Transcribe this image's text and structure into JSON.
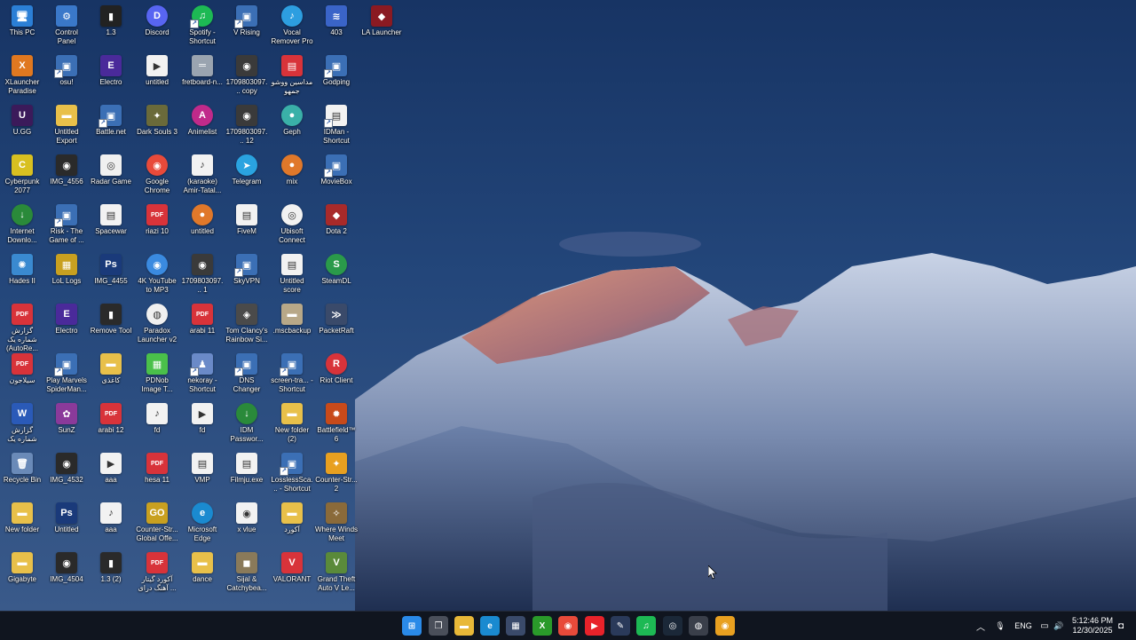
{
  "desktop_icons": [
    {
      "label": "This PC",
      "col": 0,
      "row": 0,
      "color": "#2b7fd6",
      "glyph": "🖥"
    },
    {
      "label": "Control Panel",
      "col": 1,
      "row": 0,
      "color": "#3a78c9",
      "glyph": "⚙"
    },
    {
      "label": "1.3",
      "col": 2,
      "row": 0,
      "color": "#222",
      "glyph": "▮"
    },
    {
      "label": "Discord",
      "col": 3,
      "row": 0,
      "color": "#5865f2",
      "glyph": "D",
      "round": true
    },
    {
      "label": "Spotify - Shortcut",
      "col": 4,
      "row": 0,
      "color": "#1db954",
      "glyph": "♫",
      "round": true,
      "shortcut": true
    },
    {
      "label": "V Rising",
      "col": 5,
      "row": 0,
      "color": "#3b6fb5",
      "glyph": "▣",
      "shortcut": true
    },
    {
      "label": "Vocal Remover Pro",
      "col": 6,
      "row": 0,
      "color": "#2d9ee0",
      "glyph": "♪",
      "round": true
    },
    {
      "label": "403",
      "col": 7,
      "row": 0,
      "color": "#3a64c8",
      "glyph": "≋"
    },
    {
      "label": "LA Launcher",
      "col": 8,
      "row": 0,
      "color": "#8a1a22",
      "glyph": "◆"
    },
    {
      "label": "XLauncher Paradise",
      "col": 0,
      "row": 1,
      "color": "#e07820",
      "glyph": "X"
    },
    {
      "label": "osu!",
      "col": 1,
      "row": 1,
      "color": "#3b6fb5",
      "glyph": "▣",
      "shortcut": true
    },
    {
      "label": "Electro",
      "col": 2,
      "row": 1,
      "color": "#4a2a9a",
      "glyph": "E"
    },
    {
      "label": "untitled",
      "col": 3,
      "row": 1,
      "color": "#f2f2f2",
      "glyph": "▶",
      "dark": true
    },
    {
      "label": "fretboard-n...",
      "col": 4,
      "row": 1,
      "color": "#9aa4b0",
      "glyph": "═"
    },
    {
      "label": "1709803097... copy",
      "col": 5,
      "row": 1,
      "color": "#3a3a3a",
      "glyph": "◉"
    },
    {
      "label": "مداسین ووشو جمهو",
      "col": 6,
      "row": 1,
      "color": "#d8333a",
      "glyph": "▤"
    },
    {
      "label": "Godping",
      "col": 7,
      "row": 1,
      "color": "#3b6fb5",
      "glyph": "▣",
      "shortcut": true
    },
    {
      "label": "U.GG",
      "col": 0,
      "row": 2,
      "color": "#3b1a5a",
      "glyph": "U"
    },
    {
      "label": "Untitled Export",
      "col": 1,
      "row": 2,
      "color": "#e8c04a",
      "glyph": "▬"
    },
    {
      "label": "Battle.net",
      "col": 2,
      "row": 2,
      "color": "#3b6fb5",
      "glyph": "▣",
      "shortcut": true
    },
    {
      "label": "Dark Souls 3",
      "col": 3,
      "row": 2,
      "color": "#6a6a3a",
      "glyph": "✦"
    },
    {
      "label": "Animelist",
      "col": 4,
      "row": 2,
      "color": "#c02a8a",
      "glyph": "A",
      "round": true
    },
    {
      "label": "1709803097... 12",
      "col": 5,
      "row": 2,
      "color": "#3a3a3a",
      "glyph": "◉"
    },
    {
      "label": "Geph",
      "col": 6,
      "row": 2,
      "color": "#3ab0a8",
      "glyph": "●",
      "round": true
    },
    {
      "label": "IDMan - Shortcut",
      "col": 7,
      "row": 2,
      "color": "#f2f2f2",
      "glyph": "▤",
      "dark": true,
      "shortcut": true
    },
    {
      "label": "Cyberpunk 2077",
      "col": 0,
      "row": 3,
      "color": "#d8c020",
      "glyph": "C"
    },
    {
      "label": "IMG_4556",
      "col": 1,
      "row": 3,
      "color": "#2a2a2a",
      "glyph": "◉"
    },
    {
      "label": "Radar Game",
      "col": 2,
      "row": 3,
      "color": "#f0f0f0",
      "glyph": "◎",
      "dark": true
    },
    {
      "label": "Google Chrome",
      "col": 3,
      "row": 3,
      "color": "#e84a3a",
      "glyph": "◉",
      "round": true
    },
    {
      "label": "(karaoke) Amir-Tatal...",
      "col": 4,
      "row": 3,
      "color": "#f2f2f2",
      "glyph": "♪",
      "dark": true
    },
    {
      "label": "Telegram",
      "col": 5,
      "row": 3,
      "color": "#2aa3e0",
      "glyph": "➤",
      "round": true
    },
    {
      "label": "mix",
      "col": 6,
      "row": 3,
      "color": "#e0782a",
      "glyph": "●",
      "round": true
    },
    {
      "label": "MovieBox",
      "col": 7,
      "row": 3,
      "color": "#3b6fb5",
      "glyph": "▣",
      "shortcut": true
    },
    {
      "label": "Internet Downlo...",
      "col": 0,
      "row": 4,
      "color": "#2a8a3a",
      "glyph": "↓",
      "round": true
    },
    {
      "label": "Risk - The Game of ...",
      "col": 1,
      "row": 4,
      "color": "#3b6fb5",
      "glyph": "▣",
      "shortcut": true
    },
    {
      "label": "Spacewar",
      "col": 2,
      "row": 4,
      "color": "#f2f2f2",
      "glyph": "▤",
      "dark": true
    },
    {
      "label": "riazi 10",
      "col": 3,
      "row": 4,
      "color": "#d8333a",
      "glyph": "PDF"
    },
    {
      "label": "untitled",
      "col": 4,
      "row": 4,
      "color": "#e0782a",
      "glyph": "●",
      "round": true
    },
    {
      "label": "FiveM",
      "col": 5,
      "row": 4,
      "color": "#f2f2f2",
      "glyph": "▤",
      "dark": true
    },
    {
      "label": "Ubisoft Connect",
      "col": 6,
      "row": 4,
      "color": "#f2f2f2",
      "glyph": "◎",
      "dark": true,
      "round": true
    },
    {
      "label": "Dota 2",
      "col": 7,
      "row": 4,
      "color": "#a82a2a",
      "glyph": "◆"
    },
    {
      "label": "Hades II",
      "col": 0,
      "row": 5,
      "color": "#3a8ad0",
      "glyph": "✺"
    },
    {
      "label": "LoL Logs",
      "col": 1,
      "row": 5,
      "color": "#c8a020",
      "glyph": "▦"
    },
    {
      "label": "IMG_4455",
      "col": 2,
      "row": 5,
      "color": "#1a3a7a",
      "glyph": "Ps"
    },
    {
      "label": "4K YouTube to MP3",
      "col": 3,
      "row": 5,
      "color": "#3a8ae0",
      "glyph": "◉",
      "round": true
    },
    {
      "label": "1709803097... 1",
      "col": 4,
      "row": 5,
      "color": "#3a3a3a",
      "glyph": "◉"
    },
    {
      "label": "SkyVPN",
      "col": 5,
      "row": 5,
      "color": "#3b6fb5",
      "glyph": "▣",
      "shortcut": true
    },
    {
      "label": "Untitled score",
      "col": 6,
      "row": 5,
      "color": "#f2f2f2",
      "glyph": "▤",
      "dark": true
    },
    {
      "label": "SteamDL",
      "col": 7,
      "row": 5,
      "color": "#2a9a4a",
      "glyph": "S",
      "round": true
    },
    {
      "label": "گزارش شماره یک (AutoRe...",
      "col": 0,
      "row": 6,
      "color": "#d8333a",
      "glyph": "PDF"
    },
    {
      "label": "Electro",
      "col": 1,
      "row": 6,
      "color": "#4a2a9a",
      "glyph": "E"
    },
    {
      "label": "Remove Tool",
      "col": 2,
      "row": 6,
      "color": "#2a2a2a",
      "glyph": "▮"
    },
    {
      "label": "Paradox Launcher v2",
      "col": 3,
      "row": 6,
      "color": "#f0f0f0",
      "glyph": "◍",
      "dark": true,
      "round": true
    },
    {
      "label": "arabi 11",
      "col": 4,
      "row": 6,
      "color": "#d8333a",
      "glyph": "PDF"
    },
    {
      "label": "Tom Clancy's Rainbow Si...",
      "col": 5,
      "row": 6,
      "color": "#4a4a4a",
      "glyph": "◈"
    },
    {
      "label": ".mscbackup",
      "col": 6,
      "row": 6,
      "color": "#b8a888",
      "glyph": "▬"
    },
    {
      "label": "PacketRaft",
      "col": 7,
      "row": 6,
      "color": "#3a4a6a",
      "glyph": "≫"
    },
    {
      "label": "سیلاجون",
      "col": 0,
      "row": 7,
      "color": "#d8333a",
      "glyph": "PDF"
    },
    {
      "label": "Play Marvels SpiderMan...",
      "col": 1,
      "row": 7,
      "color": "#3b6fb5",
      "glyph": "▣",
      "shortcut": true
    },
    {
      "label": "کاغذی",
      "col": 2,
      "row": 7,
      "color": "#e8c04a",
      "glyph": "▬"
    },
    {
      "label": "PDNob Image T...",
      "col": 3,
      "row": 7,
      "color": "#4ac04a",
      "glyph": "▦"
    },
    {
      "label": "nekoray - Shortcut",
      "col": 4,
      "row": 7,
      "color": "#6a8ac8",
      "glyph": "♟",
      "shortcut": true
    },
    {
      "label": "DNS Changer",
      "col": 5,
      "row": 7,
      "color": "#3b6fb5",
      "glyph": "▣",
      "shortcut": true
    },
    {
      "label": "screen-tra... - Shortcut",
      "col": 6,
      "row": 7,
      "color": "#3b6fb5",
      "glyph": "▣",
      "shortcut": true
    },
    {
      "label": "Riot Client",
      "col": 7,
      "row": 7,
      "color": "#d8333a",
      "glyph": "R",
      "round": true
    },
    {
      "label": "گزارش شماره یک",
      "col": 0,
      "row": 8,
      "color": "#2a5ab8",
      "glyph": "W"
    },
    {
      "label": "SunZ",
      "col": 1,
      "row": 8,
      "color": "#8a3a9a",
      "glyph": "✿"
    },
    {
      "label": "arabi 12",
      "col": 2,
      "row": 8,
      "color": "#d8333a",
      "glyph": "PDF"
    },
    {
      "label": "fd",
      "col": 3,
      "row": 8,
      "color": "#f2f2f2",
      "glyph": "♪",
      "dark": true
    },
    {
      "label": "fd",
      "col": 4,
      "row": 8,
      "color": "#f2f2f2",
      "glyph": "▶",
      "dark": true
    },
    {
      "label": "IDM Passwor...",
      "col": 5,
      "row": 8,
      "color": "#2a8a3a",
      "glyph": "↓",
      "round": true
    },
    {
      "label": "New folder (2)",
      "col": 6,
      "row": 8,
      "color": "#e8c04a",
      "glyph": "▬"
    },
    {
      "label": "Battlefield™ 6",
      "col": 7,
      "row": 8,
      "color": "#c84a1a",
      "glyph": "✹"
    },
    {
      "label": "Recycle Bin",
      "col": 0,
      "row": 9,
      "color": "#6a8ab8",
      "glyph": "🗑"
    },
    {
      "label": "IMG_4532",
      "col": 1,
      "row": 9,
      "color": "#2a2a2a",
      "glyph": "◉"
    },
    {
      "label": "aaa",
      "col": 2,
      "row": 9,
      "color": "#f2f2f2",
      "glyph": "▶",
      "dark": true
    },
    {
      "label": "hesa 11",
      "col": 3,
      "row": 9,
      "color": "#d8333a",
      "glyph": "PDF"
    },
    {
      "label": "VMP",
      "col": 4,
      "row": 9,
      "color": "#f2f2f2",
      "glyph": "▤",
      "dark": true
    },
    {
      "label": "Filmju.exe",
      "col": 5,
      "row": 9,
      "color": "#f2f2f2",
      "glyph": "▤",
      "dark": true
    },
    {
      "label": "LosslessSca... - Shortcut",
      "col": 6,
      "row": 9,
      "color": "#3b6fb5",
      "glyph": "▣",
      "shortcut": true
    },
    {
      "label": "Counter-Str... 2",
      "col": 7,
      "row": 9,
      "color": "#e8a020",
      "glyph": "✦"
    },
    {
      "label": "New folder",
      "col": 0,
      "row": 10,
      "color": "#e8c04a",
      "glyph": "▬"
    },
    {
      "label": "Untitled",
      "col": 1,
      "row": 10,
      "color": "#1a3a7a",
      "glyph": "Ps"
    },
    {
      "label": "aaa",
      "col": 2,
      "row": 10,
      "color": "#f2f2f2",
      "glyph": "♪",
      "dark": true
    },
    {
      "label": "Counter-Str... Global Offe...",
      "col": 3,
      "row": 10,
      "color": "#c8a020",
      "glyph": "GO"
    },
    {
      "label": "Microsoft Edge",
      "col": 4,
      "row": 10,
      "color": "#1a8ad0",
      "glyph": "e",
      "round": true
    },
    {
      "label": "x vlue",
      "col": 5,
      "row": 10,
      "color": "#f2f2f2",
      "glyph": "◉",
      "dark": true
    },
    {
      "label": "آکورد",
      "col": 6,
      "row": 10,
      "color": "#e8c04a",
      "glyph": "▬"
    },
    {
      "label": "Where Winds Meet",
      "col": 7,
      "row": 10,
      "color": "#8a6a3a",
      "glyph": "✧"
    },
    {
      "label": "Gigabyte",
      "col": 0,
      "row": 11,
      "color": "#e8c04a",
      "glyph": "▬"
    },
    {
      "label": "IMG_4504",
      "col": 1,
      "row": 11,
      "color": "#2a2a2a",
      "glyph": "◉"
    },
    {
      "label": "1.3 (2)",
      "col": 2,
      "row": 11,
      "color": "#2a2a2a",
      "glyph": "▮"
    },
    {
      "label": "آکورد گیتار آهنگ درای ...",
      "col": 3,
      "row": 11,
      "color": "#d8333a",
      "glyph": "PDF"
    },
    {
      "label": "dance",
      "col": 4,
      "row": 11,
      "color": "#e8c04a",
      "glyph": "▬"
    },
    {
      "label": "Sijal & Catchybea...",
      "col": 5,
      "row": 11,
      "color": "#8a7a5a",
      "glyph": "◼"
    },
    {
      "label": "VALORANT",
      "col": 6,
      "row": 11,
      "color": "#d8333a",
      "glyph": "V"
    },
    {
      "label": "Grand Theft Auto V Le...",
      "col": 7,
      "row": 11,
      "color": "#5a8a3a",
      "glyph": "V"
    }
  ],
  "taskbar": {
    "apps": [
      {
        "name": "start",
        "color": "#2a8ae8",
        "glyph": "⊞"
      },
      {
        "name": "task-view",
        "color": "#4a4f5a",
        "glyph": "❐"
      },
      {
        "name": "file-explorer",
        "color": "#e8b838",
        "glyph": "▬"
      },
      {
        "name": "edge",
        "color": "#1a8ad0",
        "glyph": "e"
      },
      {
        "name": "microsoft-store",
        "color": "#3a4a6a",
        "glyph": "▦"
      },
      {
        "name": "xbox",
        "color": "#2a9a2a",
        "glyph": "X"
      },
      {
        "name": "chrome",
        "color": "#e84a3a",
        "glyph": "◉"
      },
      {
        "name": "youtube",
        "color": "#e8222a",
        "glyph": "▶"
      },
      {
        "name": "pen-tool",
        "color": "#2a3a5a",
        "glyph": "✎"
      },
      {
        "name": "spotify",
        "color": "#1db954",
        "glyph": "♫"
      },
      {
        "name": "steam",
        "color": "#1b2838",
        "glyph": "◎"
      },
      {
        "name": "app-badge",
        "color": "#3a3f4a",
        "glyph": "◍"
      },
      {
        "name": "chrome-2",
        "color": "#e8a020",
        "glyph": "◉"
      }
    ],
    "tray": {
      "chevron": "︿",
      "mic": "🎙",
      "language": "ENG",
      "network": "▭",
      "volume": "🔊",
      "time": "5:12:46 PM",
      "date": "12/30/2025",
      "notification": "◘"
    }
  }
}
